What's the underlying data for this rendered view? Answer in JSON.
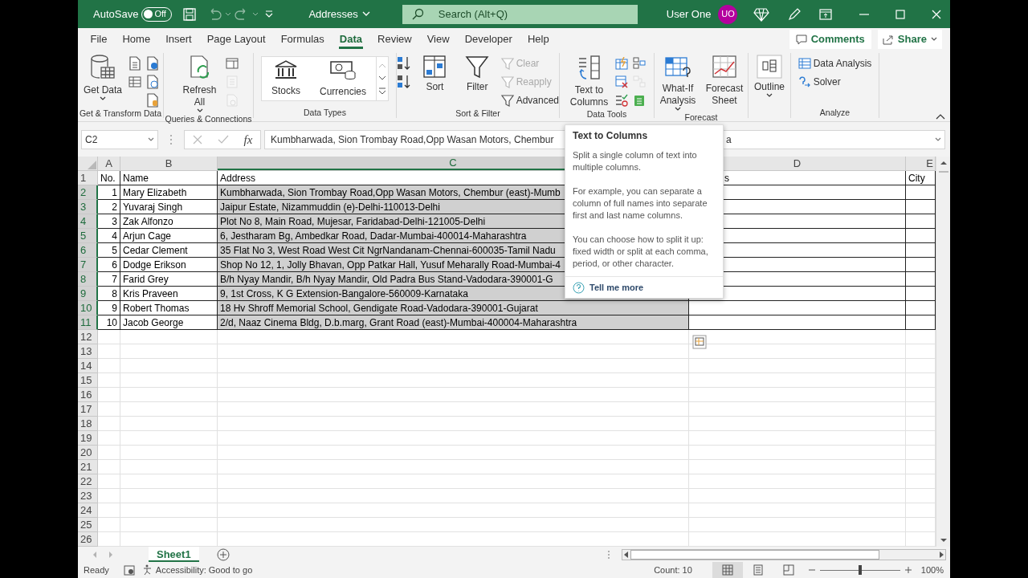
{
  "title_bar": {
    "autosave_label": "AutoSave",
    "autosave_toggle": {
      "label": "Off",
      "on": false
    },
    "document_title": "Addresses",
    "search": {
      "placeholder": "Search (Alt+Q)"
    },
    "user_name": "User One",
    "user_initials": "UO"
  },
  "menu_tabs": [
    {
      "label": "File",
      "selected": false
    },
    {
      "label": "Home",
      "selected": false
    },
    {
      "label": "Insert",
      "selected": false
    },
    {
      "label": "Page Layout",
      "selected": false
    },
    {
      "label": "Formulas",
      "selected": false
    },
    {
      "label": "Data",
      "selected": true
    },
    {
      "label": "Review",
      "selected": false
    },
    {
      "label": "View",
      "selected": false
    },
    {
      "label": "Developer",
      "selected": false
    },
    {
      "label": "Help",
      "selected": false
    }
  ],
  "comments_button": "Comments",
  "share_button": "Share",
  "ribbon_groups": [
    {
      "label": "Get & Transform Data",
      "items": [
        {
          "kind": "large",
          "label": "Get Data",
          "dropdown": true,
          "disabled": false
        },
        {
          "kind": "stack",
          "items": [
            {
              "disabled": false
            },
            {
              "disabled": false
            }
          ]
        },
        {
          "kind": "stack",
          "items": [
            {
              "disabled": false
            },
            {
              "disabled": false
            },
            {
              "disabled": false
            }
          ]
        }
      ]
    },
    {
      "label": "Queries & Connections",
      "items": [
        {
          "kind": "large",
          "label": "Refresh All",
          "dropdown": true,
          "disabled": false
        },
        {
          "kind": "stack",
          "items": [
            {
              "disabled": false
            },
            {
              "disabled": true
            },
            {
              "disabled": true
            }
          ]
        }
      ]
    },
    {
      "label": "Data Types",
      "items": [
        {
          "kind": "gallery",
          "items": [
            {
              "label": "Stocks"
            },
            {
              "label": "Currencies"
            }
          ]
        }
      ]
    },
    {
      "label": "Sort & Filter",
      "items": [
        {
          "kind": "stack",
          "items": [
            {
              "disabled": false
            },
            {
              "disabled": false
            }
          ]
        },
        {
          "kind": "large",
          "label": "Sort",
          "dropdown": false,
          "disabled": false
        },
        {
          "kind": "large",
          "label": "Filter",
          "dropdown": false,
          "disabled": false
        },
        {
          "kind": "stack",
          "items": [
            {
              "label": "Clear",
              "disabled": true
            },
            {
              "label": "Reapply",
              "disabled": true
            },
            {
              "label": "Advanced",
              "disabled": false
            }
          ]
        }
      ]
    },
    {
      "label": "Data Tools",
      "items": [
        {
          "kind": "large",
          "label": "Text to Columns",
          "dropdown": false,
          "disabled": false
        },
        {
          "kind": "stack",
          "items": [
            {
              "disabled": false
            },
            {
              "disabled": false
            },
            {
              "disabled": false
            }
          ]
        },
        {
          "kind": "stack",
          "items": [
            {
              "disabled": false
            },
            {
              "disabled": true
            },
            {
              "disabled": false
            }
          ]
        }
      ]
    },
    {
      "label": "Forecast",
      "items": [
        {
          "kind": "large",
          "label": "What-If Analysis",
          "dropdown": true,
          "disabled": false
        },
        {
          "kind": "large",
          "label": "Forecast Sheet",
          "dropdown": false,
          "disabled": false
        }
      ]
    },
    {
      "items": [
        {
          "kind": "large",
          "label": "Outline",
          "dropdown": true,
          "disabled": false
        }
      ]
    },
    {
      "label": "Analyze",
      "items": [
        {
          "kind": "stack",
          "items": [
            {
              "label": "Data Analysis",
              "disabled": false
            },
            {
              "label": "Solver",
              "disabled": false
            }
          ]
        }
      ]
    }
  ],
  "formula_bar": {
    "name_box": "C2",
    "function_label": "fx",
    "value": "Kumbharwada, Sion Trombay Road,Opp Wasan Motors, Chembur",
    "value_end": "a"
  },
  "sheet": {
    "columns": [
      {
        "label": "A",
        "selected": false
      },
      {
        "label": "B",
        "selected": false
      },
      {
        "label": "C",
        "selected": true
      },
      {
        "label": "D",
        "selected": false
      },
      {
        "label": "E",
        "selected": false
      }
    ],
    "rows": [
      {
        "number": "1",
        "selected": false,
        "cells": [
          {
            "text": "No.",
            "selected": false
          },
          {
            "text": "Name",
            "selected": false
          },
          {
            "text": "Address",
            "selected": false
          },
          {
            "text": "s",
            "selected": false
          },
          {
            "text": "City",
            "selected": false
          }
        ]
      },
      {
        "number": "2",
        "selected": true,
        "cells": [
          {
            "text": "1",
            "selected": false
          },
          {
            "text": "Mary Elizabeth",
            "selected": false
          },
          {
            "text": "Kumbharwada, Sion Trombay Road,Opp Wasan Motors, Chembur (east)-Mumb",
            "selected": true
          }
        ]
      },
      {
        "number": "3",
        "selected": true,
        "cells": [
          {
            "text": "2",
            "selected": false
          },
          {
            "text": "Yuvaraj Singh",
            "selected": false
          },
          {
            "text": "Jaipur Estate, Nizammuddin (e)-Delhi-110013-Delhi",
            "selected": true
          }
        ]
      },
      {
        "number": "4",
        "selected": true,
        "cells": [
          {
            "text": "3",
            "selected": false
          },
          {
            "text": "Zak Alfonzo",
            "selected": false
          },
          {
            "text": "Plot No 8, Main Road, Mujesar, Faridabad-Delhi-121005-Delhi",
            "selected": true
          }
        ]
      },
      {
        "number": "5",
        "selected": true,
        "cells": [
          {
            "text": "4",
            "selected": false
          },
          {
            "text": "Arjun Cage",
            "selected": false
          },
          {
            "text": "6, Jestharam Bg, Ambedkar Road, Dadar-Mumbai-400014-Maharashtra",
            "selected": true
          }
        ]
      },
      {
        "number": "6",
        "selected": true,
        "cells": [
          {
            "text": "5",
            "selected": false
          },
          {
            "text": "Cedar Clement",
            "selected": false
          },
          {
            "text": "35 Flat No 3, West Road West Cit NgrNandanam-Chennai-600035-Tamil Nadu",
            "selected": true
          }
        ]
      },
      {
        "number": "7",
        "selected": true,
        "cells": [
          {
            "text": "6",
            "selected": false
          },
          {
            "text": "Dodge Erikson",
            "selected": false
          },
          {
            "text": "Shop No 12, 1, Jolly Bhavan, Opp Patkar Hall, Yusuf Meharally Road-Mumbai-4",
            "selected": true
          }
        ]
      },
      {
        "number": "8",
        "selected": true,
        "cells": [
          {
            "text": "7",
            "selected": false
          },
          {
            "text": "Farid Grey",
            "selected": false
          },
          {
            "text": "B/h Nyay Mandir, B/h Nyay Mandir, Old Padra Bus Stand-Vadodara-390001-G",
            "selected": true
          }
        ]
      },
      {
        "number": "9",
        "selected": true,
        "cells": [
          {
            "text": "8",
            "selected": false
          },
          {
            "text": "Kris Praveen",
            "selected": false
          },
          {
            "text": "9, 1st Cross, K G Extension-Bangalore-560009-Karnataka",
            "selected": true
          }
        ]
      },
      {
        "number": "10",
        "selected": true,
        "cells": [
          {
            "text": "9",
            "selected": false
          },
          {
            "text": "Robert Thomas",
            "selected": false
          },
          {
            "text": "18 Hv Shroff Memorial School, Gendigate Road-Vadodara-390001-Gujarat",
            "selected": true
          }
        ]
      },
      {
        "number": "11",
        "selected": true,
        "cells": [
          {
            "text": "10",
            "selected": false
          },
          {
            "text": "Jacob George",
            "selected": false
          },
          {
            "text": "2/d, Naaz Cinema Bldg, D.b.marg, Grant Road (east)-Mumbai-400004-Maharashtra",
            "selected": true
          }
        ]
      },
      {
        "number": "12",
        "selected": false
      },
      {
        "number": "13",
        "selected": false
      },
      {
        "number": "14",
        "selected": false
      },
      {
        "number": "15",
        "selected": false
      },
      {
        "number": "16",
        "selected": false
      },
      {
        "number": "17",
        "selected": false
      },
      {
        "number": "18",
        "selected": false
      },
      {
        "number": "19",
        "selected": false
      },
      {
        "number": "20",
        "selected": false
      },
      {
        "number": "21",
        "selected": false
      },
      {
        "number": "22",
        "selected": false
      },
      {
        "number": "23",
        "selected": false
      },
      {
        "number": "24",
        "selected": false
      },
      {
        "number": "25",
        "selected": false
      },
      {
        "number": "26",
        "selected": false
      }
    ]
  },
  "tooltip": {
    "title": "Text to Columns",
    "paragraphs": [
      "Split a single column of text into multiple columns.",
      "For example, you can separate a column of full names into separate first and last name columns.",
      "You can choose how to split it up: fixed width or split at each comma, period, or other character."
    ],
    "link": "Tell me more"
  },
  "sheet_tabs": [
    {
      "label": "Sheet1",
      "selected": true
    }
  ],
  "status_bar": {
    "mode": "Ready",
    "accessibility": "Accessibility: Good to go",
    "count": "Count: 10",
    "views": [
      {
        "selected": true
      },
      {
        "selected": false
      },
      {
        "selected": false
      }
    ],
    "zoom": {
      "level": 0.5,
      "reading": "100%"
    }
  }
}
